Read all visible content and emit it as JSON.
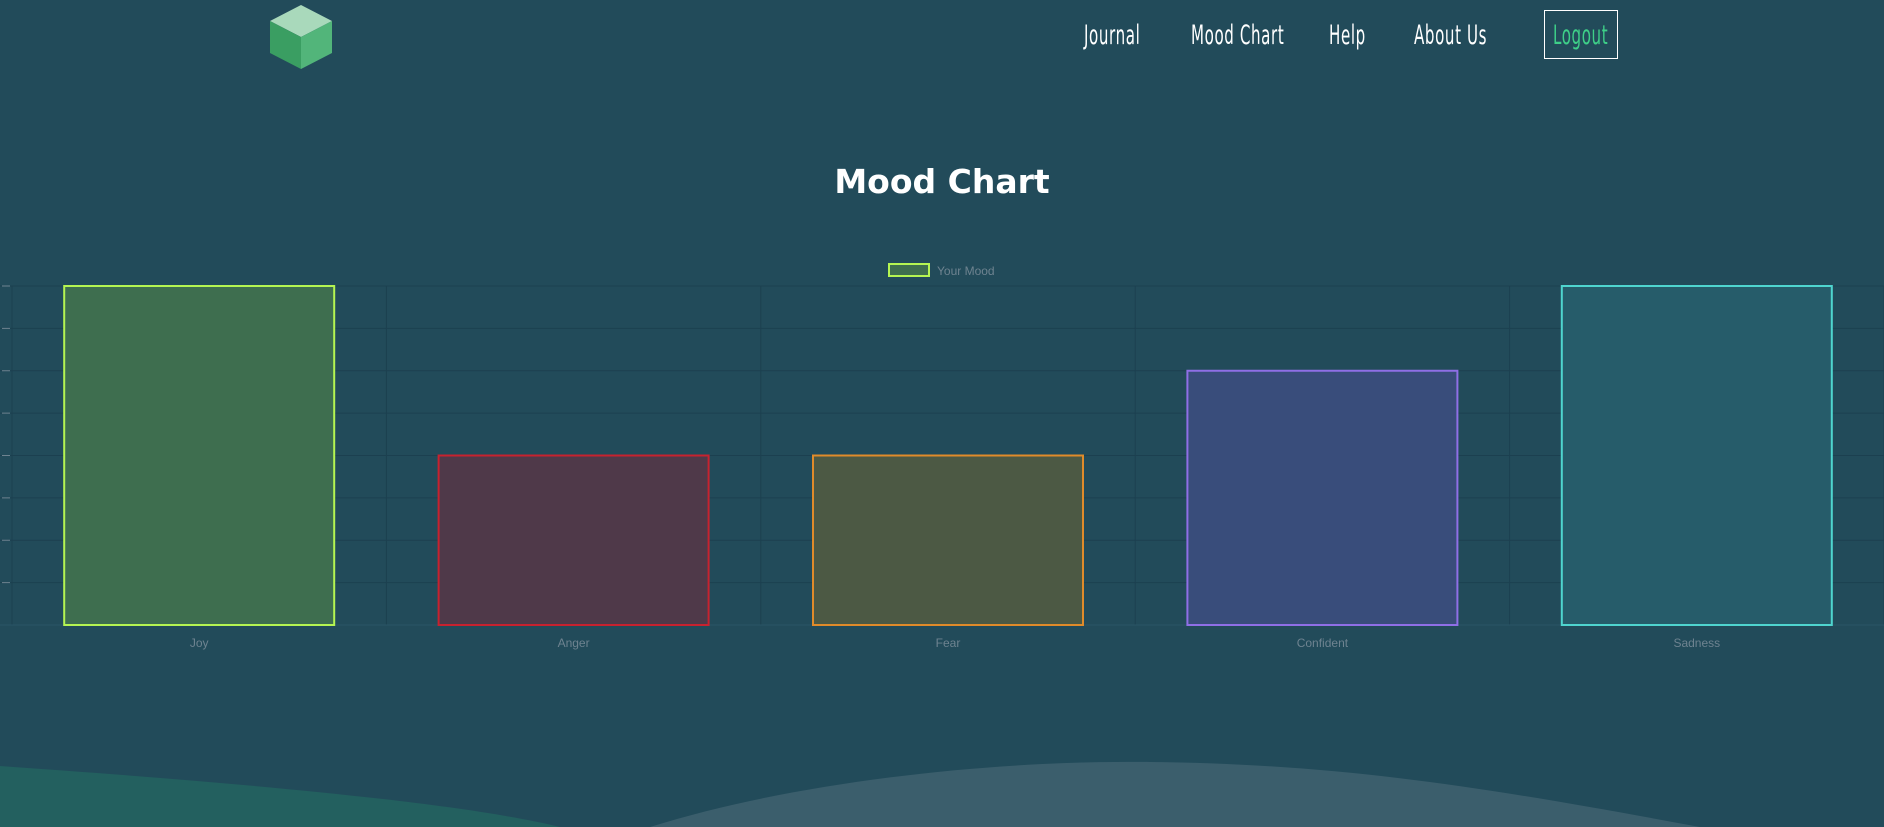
{
  "header": {
    "nav": [
      {
        "label": "Journal",
        "key": "journal"
      },
      {
        "label": "Mood Chart",
        "key": "mood-chart"
      },
      {
        "label": "Help",
        "key": "help"
      },
      {
        "label": "About Us",
        "key": "about-us"
      }
    ],
    "logout_label": "Logout"
  },
  "page": {
    "title": "Mood Chart"
  },
  "chart_data": {
    "type": "bar",
    "categories": [
      "Joy",
      "Anger",
      "Fear",
      "Confident",
      "Sadness"
    ],
    "series": [
      {
        "name": "Your Mood",
        "values": [
          4,
          2,
          2,
          3,
          4
        ],
        "fill_colors": [
          "#3e6e4f",
          "#4f3949",
          "#4c5944",
          "#394d7b",
          "#265c6a"
        ],
        "border_colors": [
          "#b5f552",
          "#c7222f",
          "#e08b2a",
          "#8f6fe6",
          "#4fd5cf"
        ]
      }
    ],
    "ylim": [
      0,
      4
    ],
    "grid": true,
    "legend_position": "top",
    "legend_swatch_color": "#b5f552"
  }
}
